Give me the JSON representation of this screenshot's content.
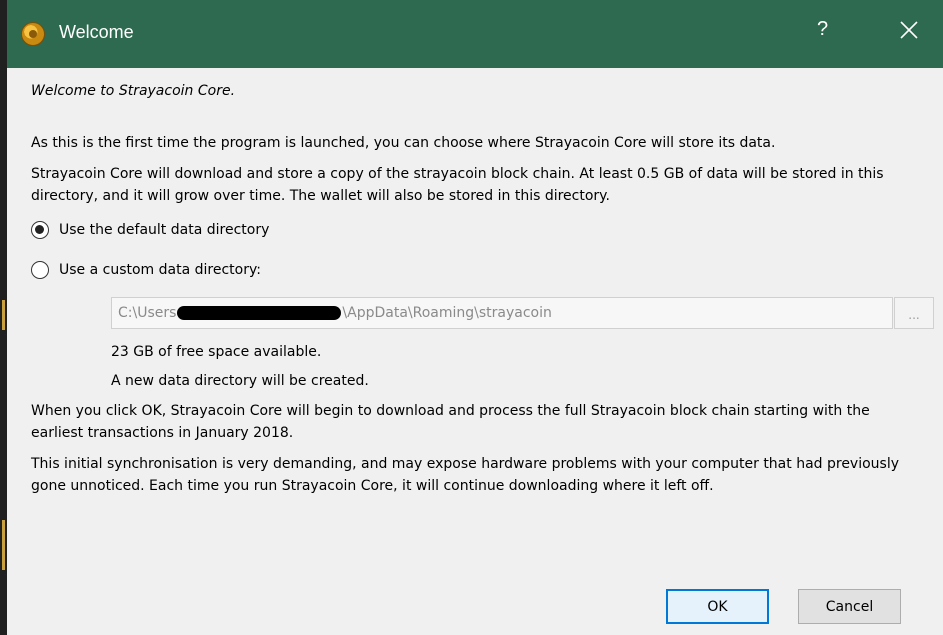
{
  "window": {
    "title": "Welcome",
    "help_glyph": "?",
    "icons": [
      "strayacoin-logo-icon",
      "close-icon"
    ]
  },
  "intro": {
    "welcome": "Welcome to Strayacoin Core.",
    "p1": "As this is the first time the program is launched, you can choose where Strayacoin Core will store its data.",
    "p2": "Strayacoin Core will download and store a copy of the strayacoin block chain. At least 0.5 GB of data will be stored in this directory, and it will grow over time. The wallet will also be stored in this directory."
  },
  "options": {
    "default_label": "Use the default data directory",
    "custom_label": "Use a custom data directory:",
    "selected": "default"
  },
  "path": {
    "prefix": "C:\\Users",
    "suffix": "\\AppData\\Roaming\\strayacoin",
    "browse_label": "..."
  },
  "status": {
    "free_space": "23 GB of free space available.",
    "new_dir": "A new data directory will be created."
  },
  "info": {
    "p5": "When you click OK, Strayacoin Core will begin to download and process the full Strayacoin block chain starting with the earliest transactions in January 2018.",
    "p6": "This initial synchronisation is very demanding, and may expose hardware problems with your computer that had previously gone unnoticed. Each time you run Strayacoin Core, it will continue downloading where it left off."
  },
  "buttons": {
    "ok": "OK",
    "cancel": "Cancel"
  },
  "colors": {
    "titlebar": "#2d6a4f",
    "ok_border": "#0078d7"
  }
}
